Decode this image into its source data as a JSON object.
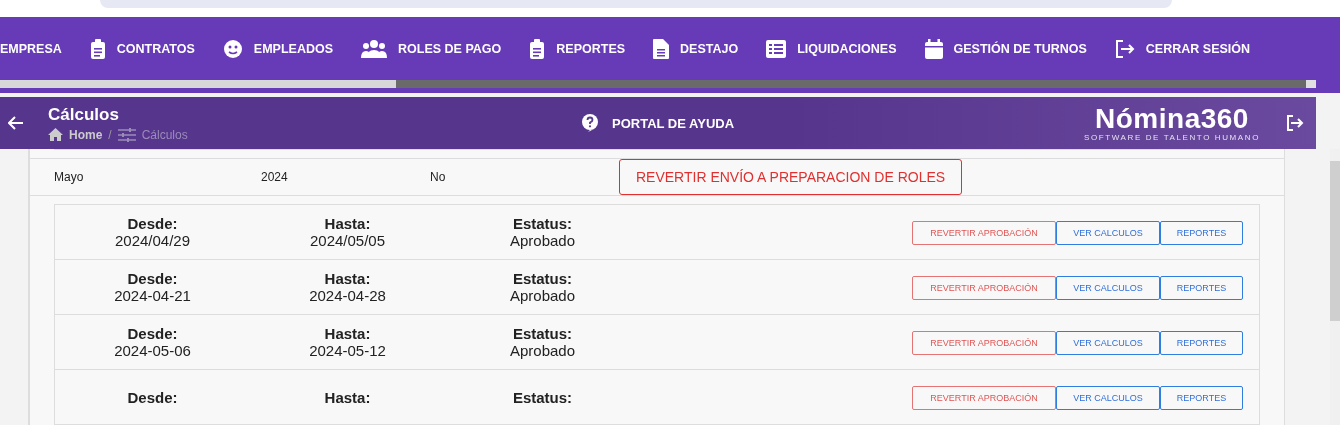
{
  "nav_items": [
    {
      "label": "EMPRESA"
    },
    {
      "label": "CONTRATOS"
    },
    {
      "label": "EMPLEADOS"
    },
    {
      "label": "ROLES DE PAGO"
    },
    {
      "label": "REPORTES"
    },
    {
      "label": "DESTAJO"
    },
    {
      "label": "LIQUIDACIONES"
    },
    {
      "label": "GESTIÓN DE TURNOS"
    },
    {
      "label": "CERRAR SESIÓN"
    }
  ],
  "header": {
    "title": "Cálculos",
    "breadcrumb": [
      {
        "label": "Home"
      },
      {
        "label": "Cálculos"
      }
    ],
    "breadcrumb_separator": "/",
    "help_link": "PORTAL DE AYUDA",
    "logo": {
      "name": "Nómina360",
      "tagline": "SOFTWARE DE TALENTO HUMANO"
    }
  },
  "period_row": {
    "month": "Mayo",
    "year": "2024",
    "sent": "No",
    "button": "REVERTIR ENVÍO A PREPARACION DE ROLES"
  },
  "weeks": [
    {
      "desde_label": "Desde:",
      "desde": "2024/04/29",
      "hasta_label": "Hasta:",
      "hasta": "2024/05/05",
      "estatus_label": "Estatus:",
      "estatus": "Aprobado",
      "buttons": [
        {
          "label": "REVERTIR APROBACIÓN",
          "kind": "danger"
        },
        {
          "label": "VER CALCULOS",
          "kind": "primary"
        },
        {
          "label": "REPORTES",
          "kind": "primary"
        }
      ]
    },
    {
      "desde_label": "Desde:",
      "desde": "2024-04-21",
      "hasta_label": "Hasta:",
      "hasta": "2024-04-28",
      "estatus_label": "Estatus:",
      "estatus": "Aprobado",
      "buttons": [
        {
          "label": "REVERTIR APROBACIÓN",
          "kind": "danger"
        },
        {
          "label": "VER CALCULOS",
          "kind": "primary"
        },
        {
          "label": "REPORTES",
          "kind": "primary"
        }
      ]
    },
    {
      "desde_label": "Desde:",
      "desde": "2024-05-06",
      "hasta_label": "Hasta:",
      "hasta": "2024-05-12",
      "estatus_label": "Estatus:",
      "estatus": "Aprobado",
      "buttons": [
        {
          "label": "REVERTIR APROBACIÓN",
          "kind": "danger"
        },
        {
          "label": "VER CALCULOS",
          "kind": "primary"
        },
        {
          "label": "REPORTES",
          "kind": "primary"
        }
      ]
    },
    {
      "desde_label": "Desde:",
      "hasta_label": "Hasta:",
      "estatus_label": "Estatus:",
      "buttons": [
        {
          "label": "REVERTIR APROBACIÓN",
          "kind": "danger"
        },
        {
          "label": "VER CALCULOS",
          "kind": "primary"
        },
        {
          "label": "REPORTES",
          "kind": "primary"
        }
      ]
    }
  ]
}
